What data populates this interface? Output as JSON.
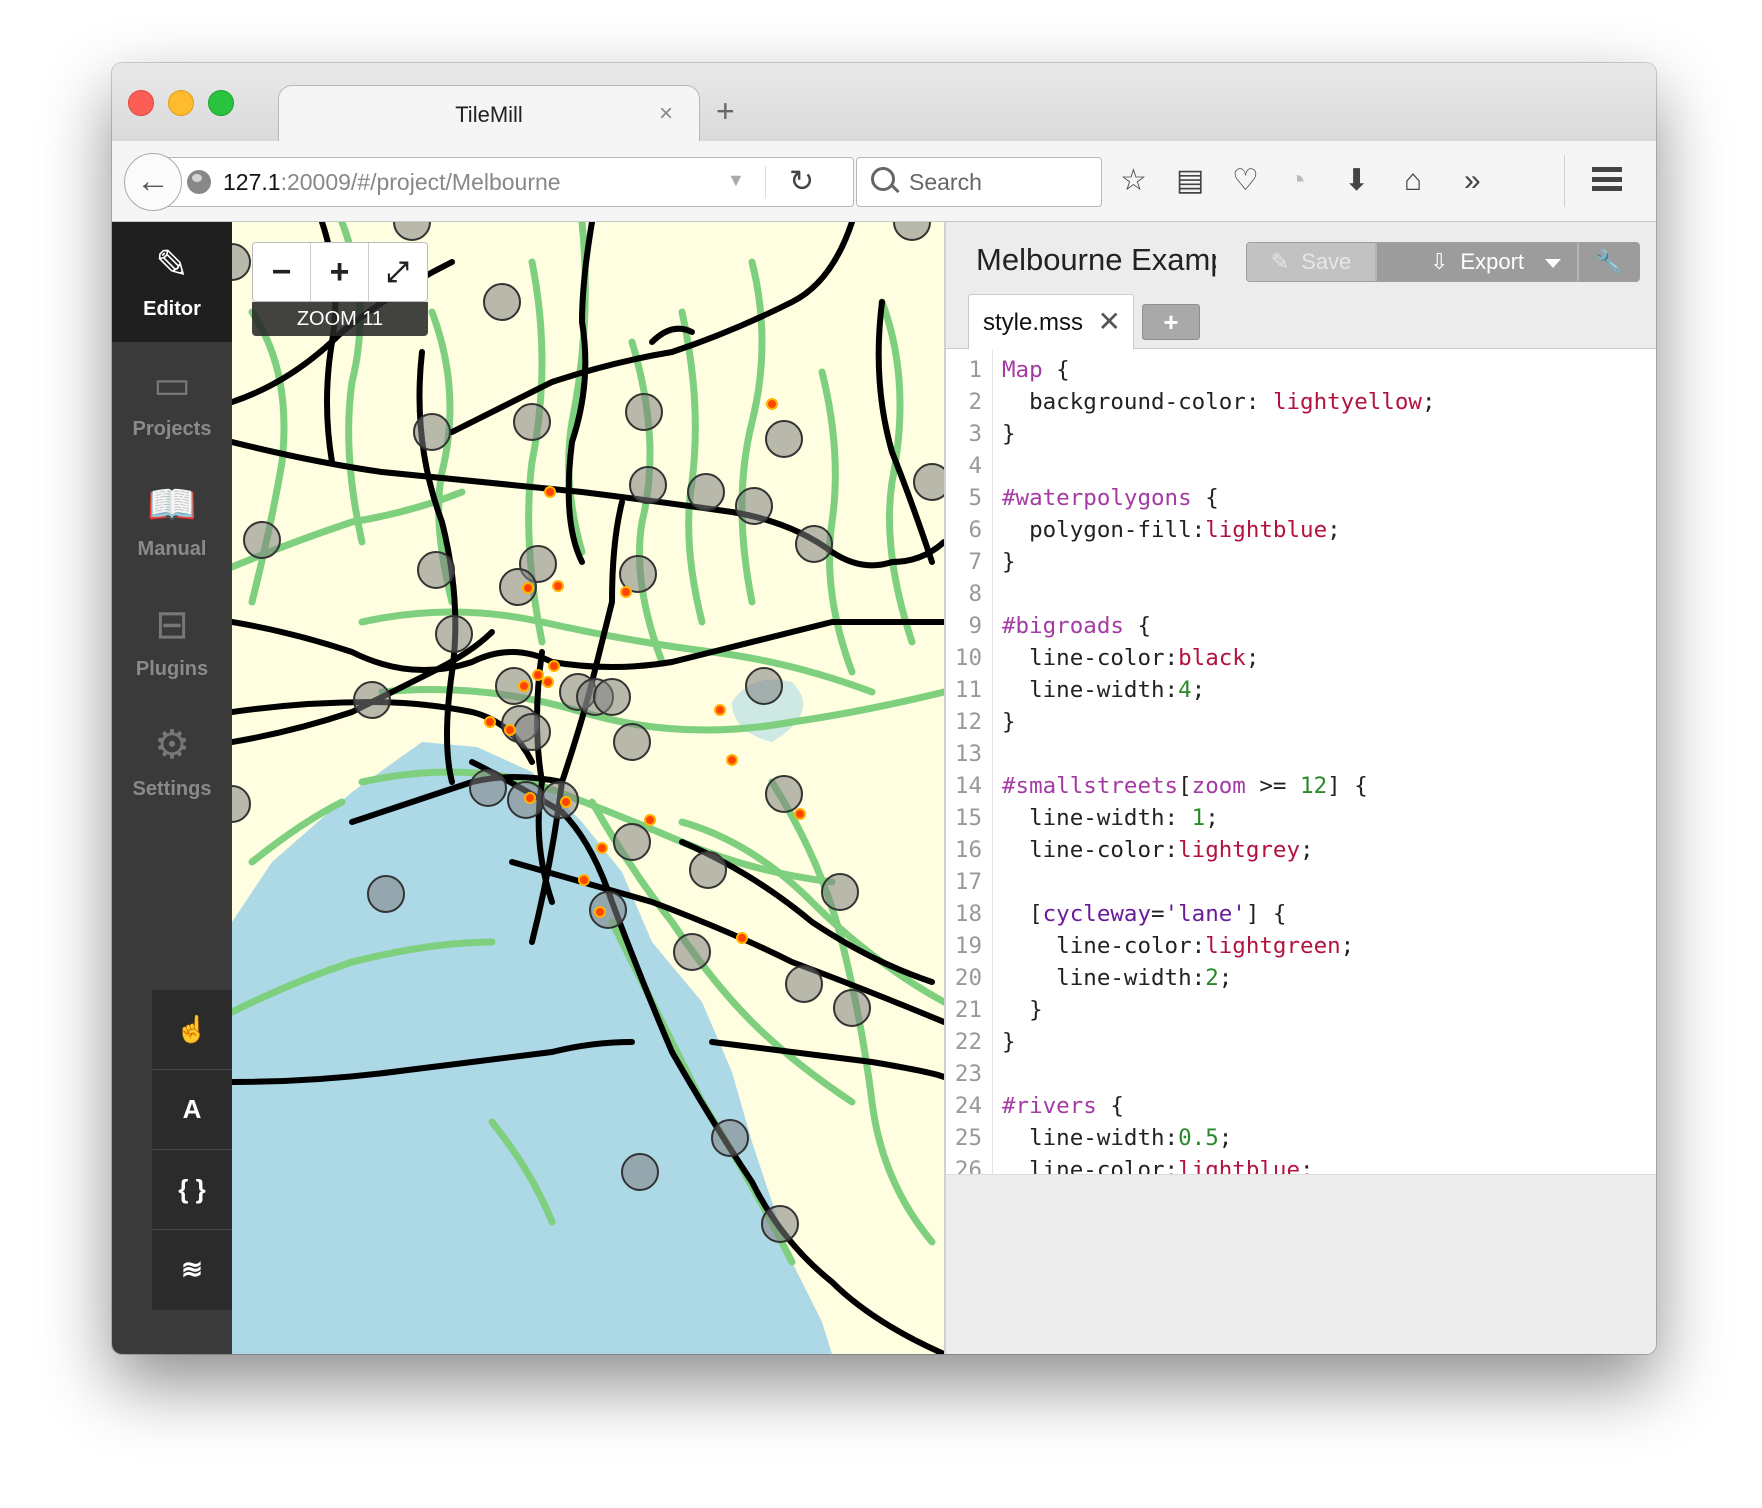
{
  "browser": {
    "tab_title": "TileMill",
    "tab_close": "×",
    "new_tab": "+",
    "url_host": "127.1",
    "url_rest": ":20009/#/project/Melbourne",
    "search_placeholder": "Search",
    "toolbar_icons": [
      "bookmark-star-icon",
      "reading-list-icon",
      "pocket-icon",
      "rss-icon",
      "download-icon",
      "home-icon",
      "overflow-icon",
      "menu-icon"
    ]
  },
  "sidebar": {
    "items": [
      {
        "label": "Editor",
        "icon": "pencil-icon",
        "active": true
      },
      {
        "label": "Projects",
        "icon": "folder-icon",
        "active": false
      },
      {
        "label": "Manual",
        "icon": "book-icon",
        "active": false
      },
      {
        "label": "Plugins",
        "icon": "plugin-icon",
        "active": false
      },
      {
        "label": "Settings",
        "icon": "gear-icon",
        "active": false
      }
    ],
    "tools": [
      {
        "glyph": "☝",
        "icon": "hand-pointer-icon"
      },
      {
        "glyph": "A",
        "icon": "font-icon"
      },
      {
        "glyph": "{ }",
        "icon": "braces-icon"
      },
      {
        "glyph": "≋",
        "icon": "layers-icon"
      }
    ]
  },
  "map": {
    "zoom_out": "−",
    "zoom_in": "+",
    "fullscreen": "⤢",
    "zoom_label": "ZOOM 11",
    "colors": {
      "land": "#fffee0",
      "water": "#add8e6",
      "bigroads": "#000000",
      "cycleway": "#7ed07e",
      "points": "#ff4500"
    }
  },
  "editor": {
    "project_title": "Melbourne Example",
    "save_label": "Save",
    "export_label": "Export",
    "file_tab": "style.mss",
    "file_tab_close": "✕",
    "add_tab": "+",
    "code_lines": [
      [
        {
          "t": "Map",
          "c": "k"
        },
        {
          "t": " {",
          "c": "p"
        }
      ],
      [
        {
          "t": "  background-color: ",
          "c": "p"
        },
        {
          "t": "lightyellow",
          "c": "v"
        },
        {
          "t": ";",
          "c": "p"
        }
      ],
      [
        {
          "t": "}",
          "c": "p"
        }
      ],
      [],
      [
        {
          "t": "#waterpolygons",
          "c": "k"
        },
        {
          "t": " {",
          "c": "p"
        }
      ],
      [
        {
          "t": "  polygon-fill:",
          "c": "p"
        },
        {
          "t": "lightblue",
          "c": "v"
        },
        {
          "t": ";",
          "c": "p"
        }
      ],
      [
        {
          "t": "}",
          "c": "p"
        }
      ],
      [],
      [
        {
          "t": "#bigroads",
          "c": "k"
        },
        {
          "t": " {",
          "c": "p"
        }
      ],
      [
        {
          "t": "  line-color:",
          "c": "p"
        },
        {
          "t": "black",
          "c": "v"
        },
        {
          "t": ";",
          "c": "p"
        }
      ],
      [
        {
          "t": "  line-width:",
          "c": "p"
        },
        {
          "t": "4",
          "c": "n"
        },
        {
          "t": ";",
          "c": "p"
        }
      ],
      [
        {
          "t": "}",
          "c": "p"
        }
      ],
      [],
      [
        {
          "t": "#smallstreets",
          "c": "k"
        },
        {
          "t": "[",
          "c": "p"
        },
        {
          "t": "zoom",
          "c": "k"
        },
        {
          "t": " >= ",
          "c": "p"
        },
        {
          "t": "12",
          "c": "n"
        },
        {
          "t": "] {",
          "c": "p"
        }
      ],
      [
        {
          "t": "  line-width: ",
          "c": "p"
        },
        {
          "t": "1",
          "c": "n"
        },
        {
          "t": ";",
          "c": "p"
        }
      ],
      [
        {
          "t": "  line-color:",
          "c": "p"
        },
        {
          "t": "lightgrey",
          "c": "v"
        },
        {
          "t": ";",
          "c": "p"
        }
      ],
      [],
      [
        {
          "t": "  [",
          "c": "p"
        },
        {
          "t": "cycleway",
          "c": "s"
        },
        {
          "t": "=",
          "c": "p"
        },
        {
          "t": "'lane'",
          "c": "s"
        },
        {
          "t": "] {",
          "c": "p"
        }
      ],
      [
        {
          "t": "    line-color:",
          "c": "p"
        },
        {
          "t": "lightgreen",
          "c": "v"
        },
        {
          "t": ";",
          "c": "p"
        }
      ],
      [
        {
          "t": "    line-width:",
          "c": "p"
        },
        {
          "t": "2",
          "c": "n"
        },
        {
          "t": ";",
          "c": "p"
        }
      ],
      [
        {
          "t": "  }",
          "c": "p"
        }
      ],
      [
        {
          "t": "}",
          "c": "p"
        }
      ],
      [],
      [
        {
          "t": "#rivers",
          "c": "k"
        },
        {
          "t": " {",
          "c": "p"
        }
      ],
      [
        {
          "t": "  line-width:",
          "c": "p"
        },
        {
          "t": "0.5",
          "c": "n"
        },
        {
          "t": ";",
          "c": "p"
        }
      ],
      [
        {
          "t": "  line-color:",
          "c": "p"
        },
        {
          "t": "lightblue",
          "c": "v"
        },
        {
          "t": ";",
          "c": "p"
        }
      ]
    ]
  }
}
